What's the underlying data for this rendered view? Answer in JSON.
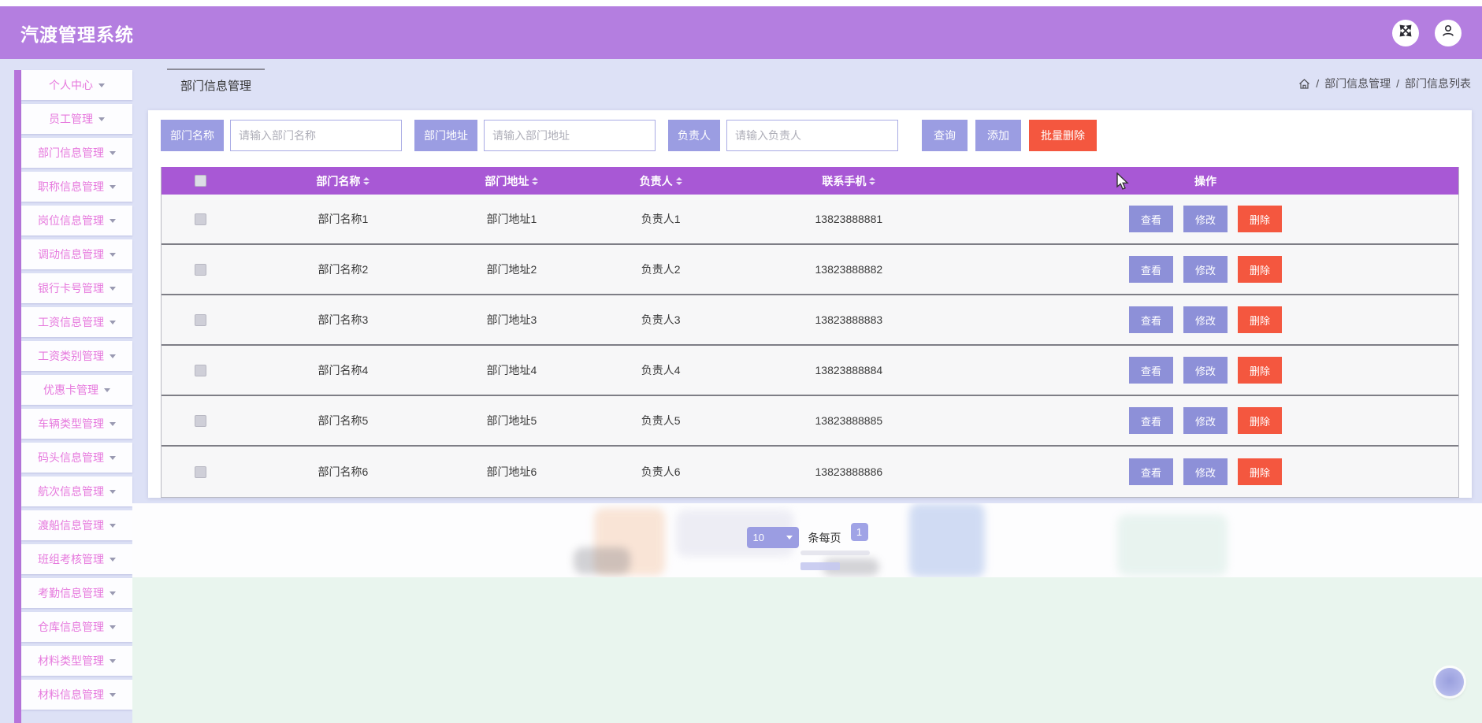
{
  "app": {
    "title": "汽渡管理系统"
  },
  "topbar": {
    "icons": [
      "fullscreen-icon",
      "user-icon"
    ]
  },
  "breadcrumb": {
    "separator": "/",
    "items": [
      "部门信息管理",
      "部门信息列表"
    ]
  },
  "sidebar": {
    "items": [
      {
        "label": "个人中心"
      },
      {
        "label": "员工管理"
      },
      {
        "label": "部门信息管理"
      },
      {
        "label": "职称信息管理"
      },
      {
        "label": "岗位信息管理"
      },
      {
        "label": "调动信息管理"
      },
      {
        "label": "银行卡号管理"
      },
      {
        "label": "工资信息管理"
      },
      {
        "label": "工资类别管理"
      },
      {
        "label": "优惠卡管理"
      },
      {
        "label": "车辆类型管理"
      },
      {
        "label": "码头信息管理"
      },
      {
        "label": "航次信息管理"
      },
      {
        "label": "渡船信息管理"
      },
      {
        "label": "班组考核管理"
      },
      {
        "label": "考勤信息管理"
      },
      {
        "label": "仓库信息管理"
      },
      {
        "label": "材料类型管理"
      },
      {
        "label": "材料信息管理"
      }
    ]
  },
  "tabs": {
    "active": "部门信息管理"
  },
  "filters": {
    "fields": [
      {
        "label": "部门名称",
        "placeholder": "请输入部门名称",
        "value": ""
      },
      {
        "label": "部门地址",
        "placeholder": "请输入部门地址",
        "value": ""
      },
      {
        "label": "负责人",
        "placeholder": "请输入负责人",
        "value": ""
      }
    ],
    "search_label": "查询",
    "add_label": "添加",
    "batch_delete_label": "批量删除"
  },
  "table": {
    "columns": [
      {
        "label": "部门名称",
        "sortable": true
      },
      {
        "label": "部门地址",
        "sortable": true
      },
      {
        "label": "负责人",
        "sortable": true
      },
      {
        "label": "联系手机",
        "sortable": true
      },
      {
        "label": "操作",
        "sortable": false
      }
    ],
    "rows": [
      {
        "name": "部门名称1",
        "address": "部门地址1",
        "person": "负责人1",
        "phone": "13823888881"
      },
      {
        "name": "部门名称2",
        "address": "部门地址2",
        "person": "负责人2",
        "phone": "13823888882"
      },
      {
        "name": "部门名称3",
        "address": "部门地址3",
        "person": "负责人3",
        "phone": "13823888883"
      },
      {
        "name": "部门名称4",
        "address": "部门地址4",
        "person": "负责人4",
        "phone": "13823888884"
      },
      {
        "name": "部门名称5",
        "address": "部门地址5",
        "person": "负责人5",
        "phone": "13823888885"
      },
      {
        "name": "部门名称6",
        "address": "部门地址6",
        "person": "负责人6",
        "phone": "13823888886"
      }
    ],
    "row_actions": {
      "view": "查看",
      "edit": "修改",
      "delete": "删除"
    }
  },
  "pagination": {
    "page_size": "10",
    "unit_label": "条每页",
    "current_page": "1"
  },
  "colors": {
    "header": "#b47ee0",
    "accent": "#9b9de2",
    "table_header": "#a858d5",
    "danger": "#f4573f",
    "sidebar_text": "#e678dd",
    "page_bg": "#dde1f6",
    "mint": "#e9f5ee"
  }
}
